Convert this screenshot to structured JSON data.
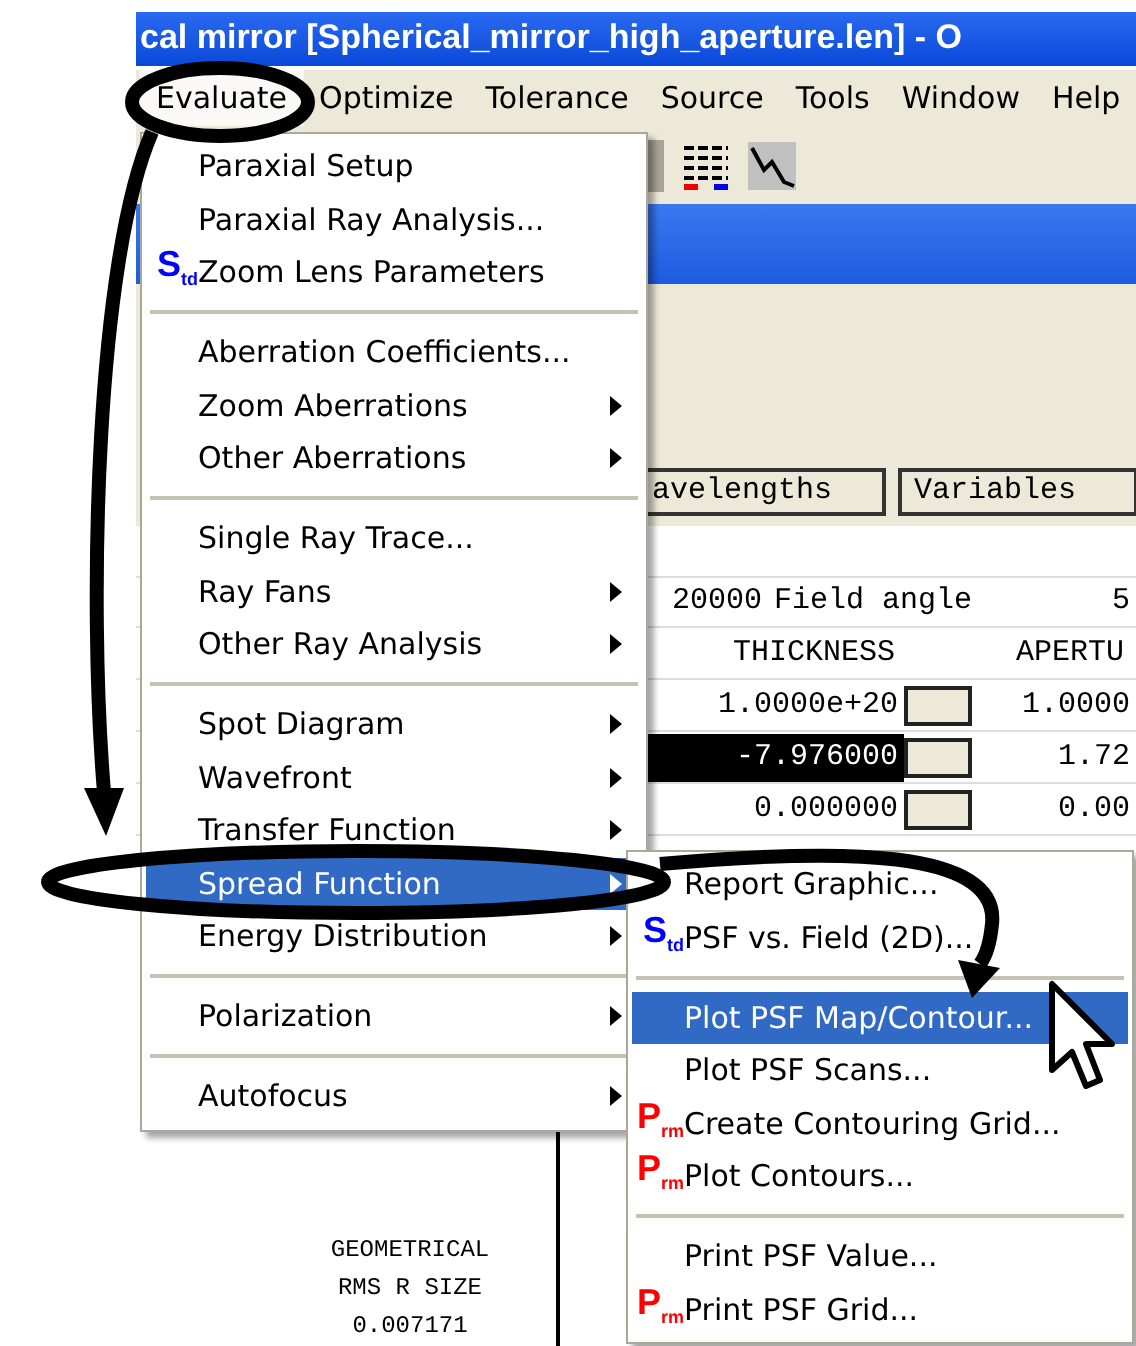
{
  "window": {
    "title": "cal mirror [Spherical_mirror_high_aperture.len] - O"
  },
  "menu_bar": [
    {
      "label": "Evaluate",
      "selected": true
    },
    {
      "label": "Optimize",
      "selected": false
    },
    {
      "label": "Tolerance",
      "selected": false
    },
    {
      "label": "Source",
      "selected": false
    },
    {
      "label": "Tools",
      "selected": false
    },
    {
      "label": "Window",
      "selected": false
    },
    {
      "label": "Help",
      "selected": false
    }
  ],
  "evaluate_menu": [
    {
      "kind": "item",
      "label": "Paraxial Setup",
      "selected": false,
      "submenu": false
    },
    {
      "kind": "item",
      "label": "Paraxial Ray Analysis...",
      "selected": false,
      "submenu": false
    },
    {
      "kind": "item",
      "label": "Zoom Lens Parameters",
      "selected": false,
      "submenu": false,
      "badge": {
        "letter": "S",
        "sub": "td",
        "color": "#0000ff"
      }
    },
    {
      "kind": "separator"
    },
    {
      "kind": "item",
      "label": "Aberration Coefficients...",
      "selected": false,
      "submenu": false
    },
    {
      "kind": "item",
      "label": "Zoom Aberrations",
      "selected": false,
      "submenu": true
    },
    {
      "kind": "item",
      "label": "Other Aberrations",
      "selected": false,
      "submenu": true
    },
    {
      "kind": "separator"
    },
    {
      "kind": "item",
      "label": "Single Ray Trace...",
      "selected": false,
      "submenu": false
    },
    {
      "kind": "item",
      "label": "Ray Fans",
      "selected": false,
      "submenu": true
    },
    {
      "kind": "item",
      "label": "Other Ray Analysis",
      "selected": false,
      "submenu": true
    },
    {
      "kind": "separator"
    },
    {
      "kind": "item",
      "label": "Spot Diagram",
      "selected": false,
      "submenu": true
    },
    {
      "kind": "item",
      "label": "Wavefront",
      "selected": false,
      "submenu": true
    },
    {
      "kind": "item",
      "label": "Transfer Function",
      "selected": false,
      "submenu": true
    },
    {
      "kind": "item",
      "label": "Spread Function",
      "selected": true,
      "submenu": true
    },
    {
      "kind": "item",
      "label": "Energy Distribution",
      "selected": false,
      "submenu": true
    },
    {
      "kind": "separator"
    },
    {
      "kind": "item",
      "label": "Polarization",
      "selected": false,
      "submenu": true
    },
    {
      "kind": "separator"
    },
    {
      "kind": "item",
      "label": "Autofocus",
      "selected": false,
      "submenu": true
    }
  ],
  "spread_function_submenu": [
    {
      "kind": "item",
      "label": "Report Graphic...",
      "selected": false,
      "submenu": false
    },
    {
      "kind": "item",
      "label": "PSF vs. Field (2D)...",
      "selected": false,
      "submenu": false,
      "badge": {
        "letter": "S",
        "sub": "td",
        "color": "#0000ff"
      }
    },
    {
      "kind": "separator"
    },
    {
      "kind": "item",
      "label": "Plot PSF Map/Contour...",
      "selected": true,
      "submenu": false
    },
    {
      "kind": "item",
      "label": "Plot PSF Scans...",
      "selected": false,
      "submenu": false
    },
    {
      "kind": "item",
      "label": "Create Contouring Grid...",
      "selected": false,
      "submenu": false,
      "badge": {
        "letter": "P",
        "sub": "rm",
        "color": "#ff0000"
      }
    },
    {
      "kind": "item",
      "label": "Plot Contours...",
      "selected": false,
      "submenu": false,
      "badge": {
        "letter": "P",
        "sub": "rm",
        "color": "#ff0000"
      }
    },
    {
      "kind": "separator"
    },
    {
      "kind": "item",
      "label": "Print PSF Value...",
      "selected": false,
      "submenu": false
    },
    {
      "kind": "item",
      "label": "Print PSF Grid...",
      "selected": false,
      "submenu": false,
      "badge": {
        "letter": "P",
        "sub": "rm",
        "color": "#ff0000"
      }
    }
  ],
  "editor": {
    "buttons": [
      "avelengths",
      "Variables"
    ],
    "info_row": {
      "value": "20000",
      "label": "Field angle",
      "value_2": "5"
    },
    "columns": [
      "THICKNESS",
      "APERTU"
    ],
    "rows": [
      {
        "thickness": "1.0000e+20",
        "aperture": "1.0000",
        "selected": false
      },
      {
        "thickness": "-7.976000",
        "aperture": "1.72",
        "selected": true
      },
      {
        "thickness": "0.000000",
        "aperture": "0.00",
        "selected": false
      }
    ]
  },
  "plot": {
    "label_lines": [
      "GEOMETRICAL",
      "RMS R SIZE",
      "0.007171"
    ]
  }
}
